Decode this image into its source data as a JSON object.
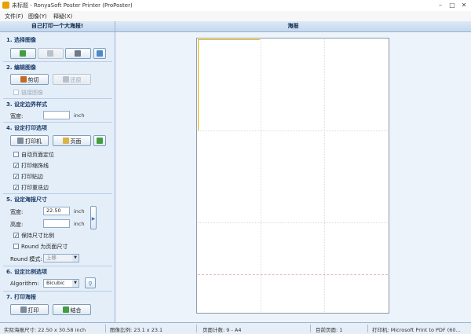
{
  "window": {
    "title": "未标题 - RonyaSoft Poster Printer (ProPoster)",
    "controls": [
      "–",
      "□",
      "✕"
    ]
  },
  "menu": [
    "文件(F)",
    "图像(Y)",
    "释疑(X)"
  ],
  "left_panel": {
    "header": "自己打印一个大海报!",
    "sec1": {
      "title": "1. 选择图像"
    },
    "sec2": {
      "title": "2. 编辑图像",
      "crop": "剪切",
      "restore": "还原",
      "link": "链接图像"
    },
    "sec3": {
      "title": "3. 设定边界样式",
      "width_label": "宽度:",
      "width_value": "",
      "unit": "inch"
    },
    "sec4": {
      "title": "4. 设定打印选项",
      "printer": "打印机",
      "page": "页面",
      "checks": [
        {
          "label": "自动页面定位",
          "checked": false
        },
        {
          "label": "打印缩饰线",
          "checked": true
        },
        {
          "label": "打印贴边",
          "checked": true
        },
        {
          "label": "打印重迭边",
          "checked": true
        }
      ]
    },
    "sec5": {
      "title": "5. 设定海报尺寸",
      "width_label": "宽度:",
      "width_value": "22.50",
      "height_label": "高度:",
      "height_value": "",
      "unit": "inch",
      "keep_ratio": "保持尺寸比例",
      "round_page": "Round 为页面尺寸",
      "round_mode_label": "Round 模式:",
      "round_mode_value": "上移"
    },
    "sec6": {
      "title": "6. 设定比例选项",
      "algorithm_label": "Algorithm:",
      "algorithm_value": "Bicubic"
    },
    "sec7": {
      "title": "7. 打印海报",
      "print": "打印",
      "merge": "结合"
    }
  },
  "main": {
    "header": "海报"
  },
  "status": [
    "实际海报尺寸: 22.50 x 30.58 inch",
    "图像比例: 23.1 x 23.1",
    "页面计数: 9 - A4",
    "目前页面: 1",
    "打印机: Microsoft Print to PDF (60..."
  ]
}
